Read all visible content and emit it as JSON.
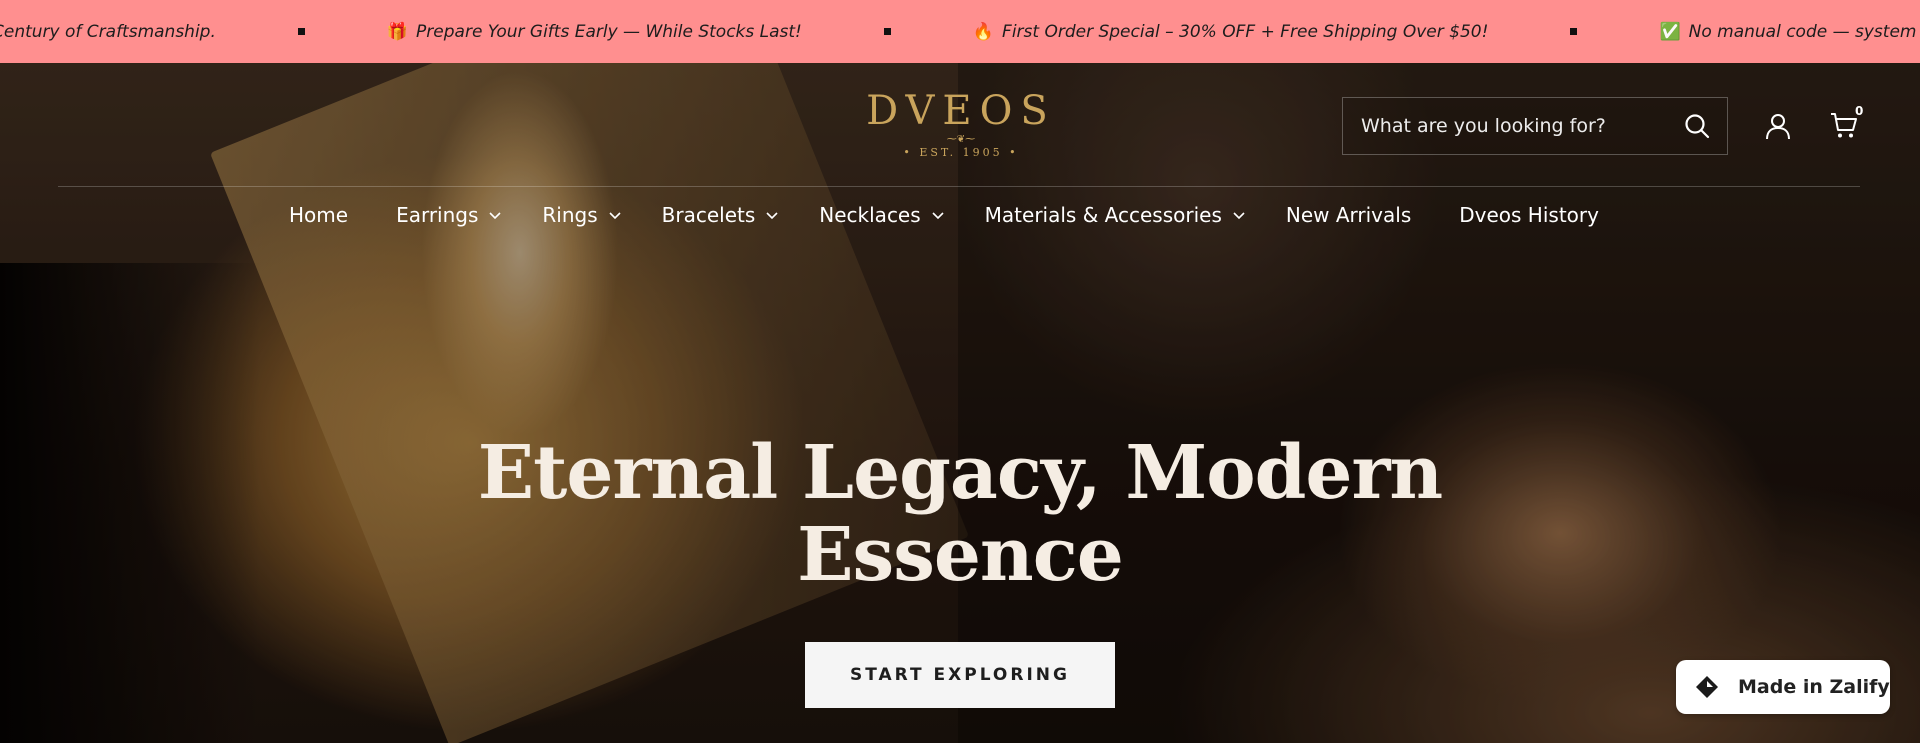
{
  "announcement": {
    "items": [
      {
        "emoji": "",
        "text": "Century of Craftsmanship."
      },
      {
        "emoji": "🎁",
        "text": "Prepare Your Gifts Early — While Stocks Last!"
      },
      {
        "emoji": "🔥",
        "text": "First Order Special – 30% OFF + Free Shipping Over $50!"
      },
      {
        "emoji": "✅",
        "text": "No manual code — system app"
      }
    ],
    "background_color": "#ff8f8f"
  },
  "header": {
    "logo": {
      "name": "DVEOS",
      "flourish": "⁓❦⁓",
      "est": "• EST. 1905 •",
      "color": "#c9a45c"
    },
    "search": {
      "placeholder": "What are you looking for?"
    },
    "icons": {
      "search": "search-icon",
      "account": "account-icon",
      "cart": "cart-icon"
    },
    "cart_count": "0"
  },
  "nav": {
    "items": [
      {
        "label": "Home",
        "has_dropdown": false
      },
      {
        "label": "Earrings",
        "has_dropdown": true
      },
      {
        "label": "Rings",
        "has_dropdown": true
      },
      {
        "label": "Bracelets",
        "has_dropdown": true
      },
      {
        "label": "Necklaces",
        "has_dropdown": true
      },
      {
        "label": "Materials & Accessories",
        "has_dropdown": true
      },
      {
        "label": "New Arrivals",
        "has_dropdown": false
      },
      {
        "label": "Dveos History",
        "has_dropdown": false
      }
    ]
  },
  "hero": {
    "headline_line1": "Eternal Legacy, Modern",
    "headline_line2": "Essence",
    "cta_label": "START EXPLORING"
  },
  "badge": {
    "label": "Made in Zalify",
    "icon": "zalify-logo-icon"
  }
}
